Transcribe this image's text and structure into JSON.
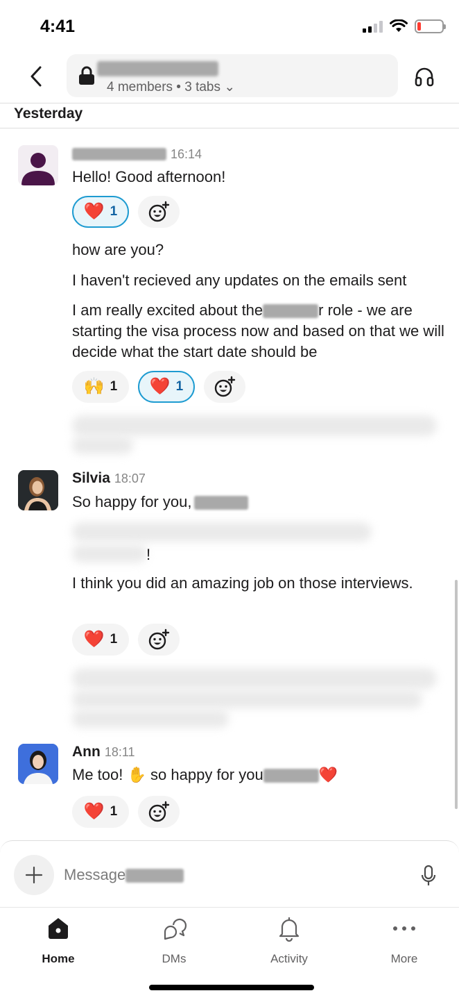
{
  "status_bar": {
    "time": "4:41",
    "battery_level": 0.15
  },
  "header": {
    "channel_subtitle": "4 members • 3 tabs ⌄"
  },
  "day_divider": "Yesterday",
  "messages": [
    {
      "author": "",
      "time": "16:14",
      "lines": [
        "Hello! Good afternoon!",
        "how are you?",
        "I haven't recieved any updates on the emails sent",
        "I am really excited about the",
        "r role - we are starting the visa process now and based on that we will decide what the start date should be"
      ],
      "reactions_1": [
        {
          "emoji": "❤️",
          "count": "1",
          "active": true
        }
      ],
      "reactions_2": [
        {
          "emoji": "🙌",
          "count": "1",
          "active": false
        },
        {
          "emoji": "❤️",
          "count": "1",
          "active": true
        }
      ]
    },
    {
      "author": "Silvia",
      "time": "18:07",
      "lines": [
        "So happy for you,",
        "!",
        "I think you did an amazing job on those interviews."
      ],
      "reactions": [
        {
          "emoji": "❤️",
          "count": "1",
          "active": false
        }
      ]
    },
    {
      "author": "Ann",
      "time": "18:11",
      "lines": [
        "Me too!",
        "✋",
        "so happy for you",
        "❤️"
      ],
      "reactions": [
        {
          "emoji": "❤️",
          "count": "1",
          "active": false
        }
      ]
    }
  ],
  "composer": {
    "placeholder": "Message"
  },
  "tabs": [
    {
      "label": "Home",
      "icon": "home-icon",
      "active": true
    },
    {
      "label": "DMs",
      "icon": "dms-icon",
      "active": false
    },
    {
      "label": "Activity",
      "icon": "bell-icon",
      "active": false
    },
    {
      "label": "More",
      "icon": "more-icon",
      "active": false
    }
  ],
  "colors": {
    "accent_blue": "#1d9bd1",
    "reaction_active_bg": "#e8f5fa",
    "text": "#1d1c1d",
    "muted": "#868686"
  }
}
